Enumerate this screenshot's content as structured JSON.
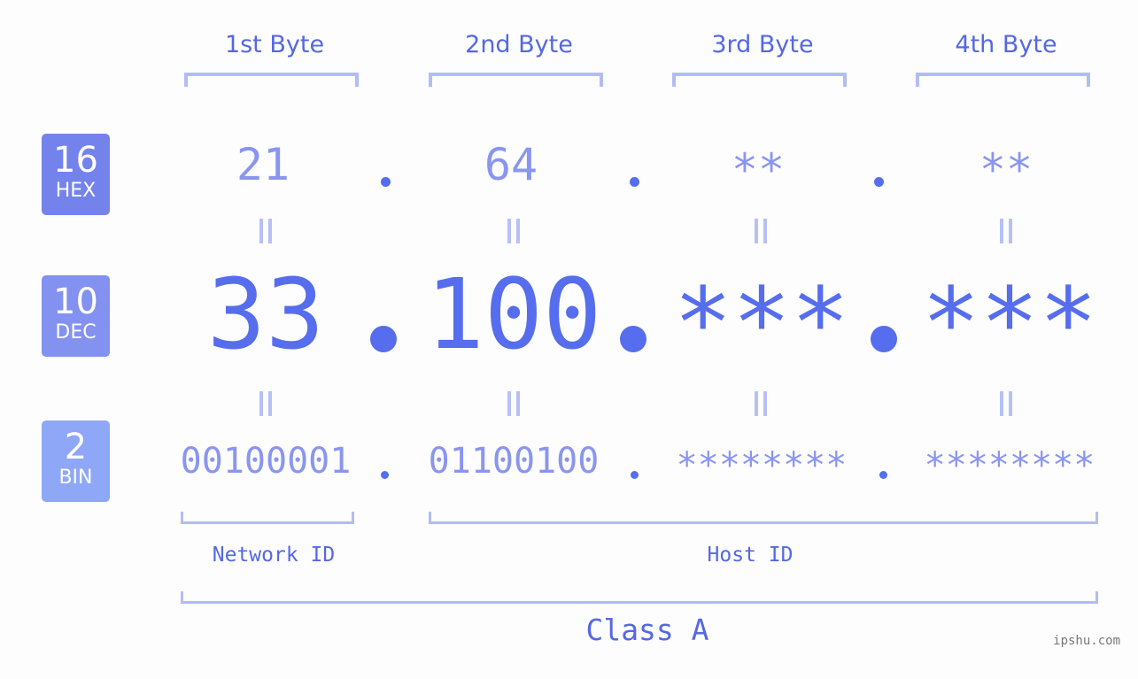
{
  "bases": [
    {
      "num": "16",
      "label": "HEX",
      "color": "#7483ec"
    },
    {
      "num": "10",
      "label": "DEC",
      "color": "#8392f0"
    },
    {
      "num": "2",
      "label": "BIN",
      "color": "#8fa7f7"
    }
  ],
  "bytes": [
    {
      "header": "1st Byte",
      "hex": "21",
      "dec": "33",
      "bin": "00100001"
    },
    {
      "header": "2nd Byte",
      "hex": "64",
      "dec": "100",
      "bin": "01100100"
    },
    {
      "header": "3rd Byte",
      "hex": "**",
      "dec": "***",
      "bin": "********"
    },
    {
      "header": "4th Byte",
      "hex": "**",
      "dec": "***",
      "bin": "********"
    }
  ],
  "labels": {
    "network_id": "Network ID",
    "host_id": "Host ID",
    "class": "Class A"
  },
  "watermark": "ipshu.com"
}
